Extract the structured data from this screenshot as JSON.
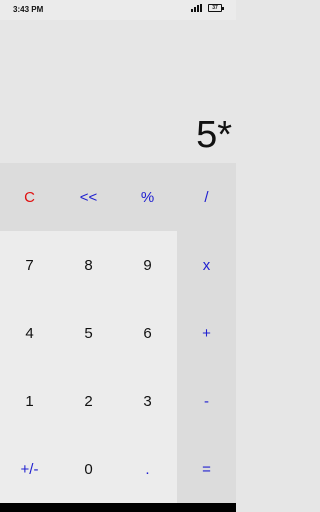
{
  "status_bar": {
    "time": "3:43 PM",
    "battery": "37"
  },
  "display": {
    "expression": "5*"
  },
  "colors": {
    "operator": "#2020d0",
    "clear": "#e01010",
    "digit": "#111111"
  },
  "keys": {
    "clear": "C",
    "backspace": "<<",
    "percent": "%",
    "divide": "/",
    "seven": "7",
    "eight": "8",
    "nine": "9",
    "multiply": "x",
    "four": "4",
    "five": "5",
    "six": "6",
    "add": "+",
    "one": "1",
    "two": "2",
    "three": "3",
    "subtract": "-",
    "sign": "+/-",
    "zero": "0",
    "decimal": ".",
    "equals": "="
  }
}
